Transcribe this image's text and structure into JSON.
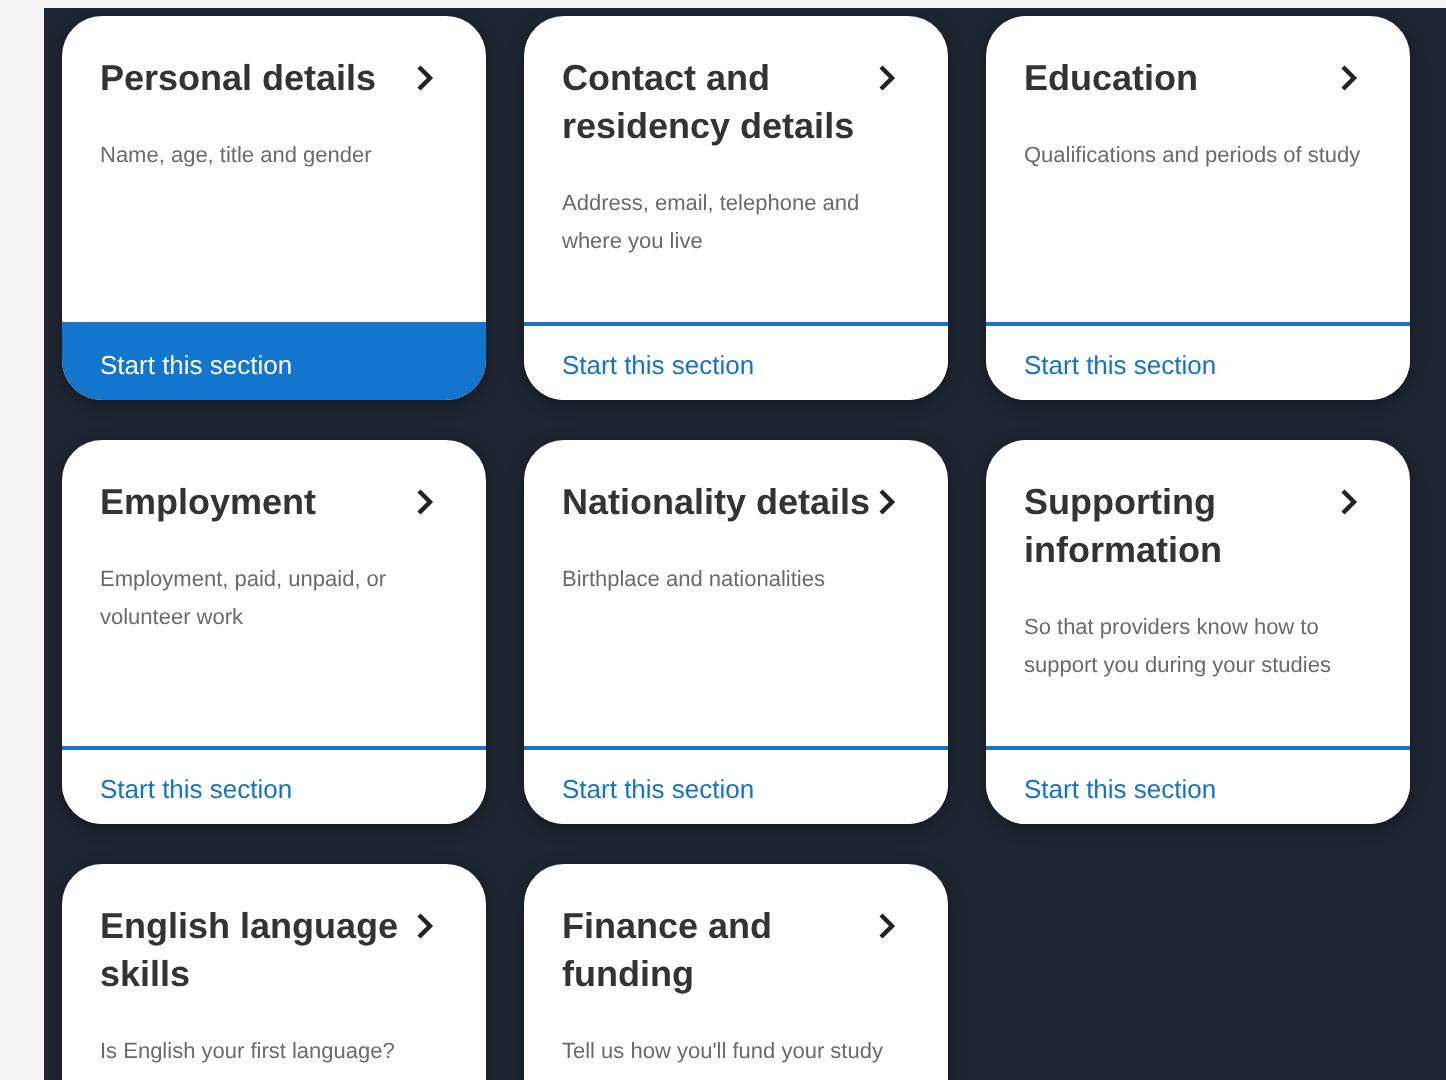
{
  "sections": [
    {
      "title": "Personal details",
      "description": "Name, age, title and gender",
      "action": "Start this section",
      "selected": true
    },
    {
      "title": "Contact and residency details",
      "description": "Address, email, telephone and where you live",
      "action": "Start this section",
      "selected": false
    },
    {
      "title": "Education",
      "description": "Qualifications and periods of study",
      "action": "Start this section",
      "selected": false
    },
    {
      "title": "Employment",
      "description": "Employment, paid, unpaid, or volunteer work",
      "action": "Start this section",
      "selected": false
    },
    {
      "title": "Nationality details",
      "description": "Birthplace and nationalities",
      "action": "Start this section",
      "selected": false
    },
    {
      "title": "Supporting information",
      "description": "So that providers know how to support you during your studies",
      "action": "Start this section",
      "selected": false
    },
    {
      "title": "English language skills",
      "description": "Is English your first language?"
    },
    {
      "title": "Finance and funding",
      "description": "Tell us how you'll fund your study"
    }
  ]
}
